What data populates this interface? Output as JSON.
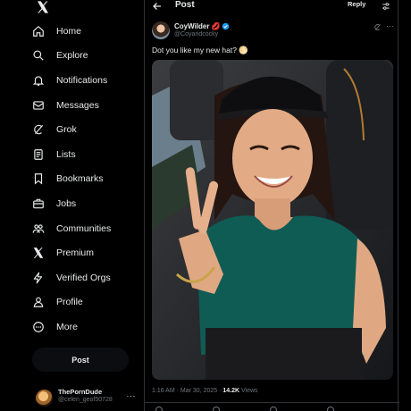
{
  "sidebar": {
    "logo": "x-logo-icon",
    "items": [
      {
        "label": "Home",
        "icon": "home-icon"
      },
      {
        "label": "Explore",
        "icon": "search-icon"
      },
      {
        "label": "Notifications",
        "icon": "bell-icon"
      },
      {
        "label": "Messages",
        "icon": "envelope-icon"
      },
      {
        "label": "Grok",
        "icon": "grok-icon"
      },
      {
        "label": "Lists",
        "icon": "list-icon"
      },
      {
        "label": "Bookmarks",
        "icon": "bookmark-icon"
      },
      {
        "label": "Jobs",
        "icon": "briefcase-icon"
      },
      {
        "label": "Communities",
        "icon": "people-icon"
      },
      {
        "label": "Premium",
        "icon": "x-logo-icon"
      },
      {
        "label": "Verified Orgs",
        "icon": "lightning-icon"
      },
      {
        "label": "Profile",
        "icon": "person-icon"
      },
      {
        "label": "More",
        "icon": "more-circle-icon"
      }
    ],
    "post_button": "Post",
    "account": {
      "name": "ThePornDude",
      "handle": "@celen_geof50728",
      "more": "···"
    }
  },
  "header": {
    "title": "Post",
    "reply_label": "Reply"
  },
  "post": {
    "author_name": "CoyWilder",
    "author_emoji": "💋",
    "author_handle": "@Coyandcocky",
    "more": "···",
    "text": "Dot you like my new hat? 🌕",
    "meta_time": "1:16 AM · Mar 30, 2025 · ",
    "meta_views_count": "14.2K",
    "meta_views_label": " Views"
  },
  "colors": {
    "background": "#000000",
    "text": "#e7e9ea",
    "muted": "#71767b",
    "border": "#2f3336",
    "verified": "#1d9bf0",
    "shirt": "#0f5c55"
  }
}
